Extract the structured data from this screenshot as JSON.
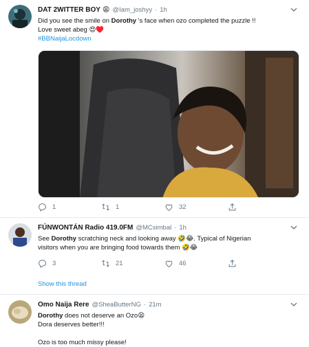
{
  "tweets": [
    {
      "name": "DAT 2WITTER BOY",
      "name_emoji": "😩",
      "handle": "@Iam_joshyy",
      "dot": "·",
      "time": "1h",
      "text_pre": "Did you see the smile on ",
      "text_bold": "Dorothy",
      "text_post": " 's face when ozo completed the puzzle !!",
      "text_line2": "Love sweet abeg 😍♥️",
      "hashtag": "#BBNaijaLocdown",
      "reply_count": "1",
      "retweet_count": "1",
      "like_count": "32"
    },
    {
      "name": "FÚNWONTÁN Radio 419.0FM",
      "handle": "@MCsimbal",
      "dot": "·",
      "time": "1h",
      "text_pre": "See ",
      "text_bold": "Dorothy",
      "text_post": " scratching neck and looking away 🤣😂. Typical of Nigerian",
      "text_line2": "visitors when you are bringing food towards them 🤣😂",
      "reply_count": "3",
      "retweet_count": "21",
      "like_count": "46",
      "show_thread": "Show this thread"
    },
    {
      "name": "Omo Naija Rere",
      "handle": "@SheaButterNG",
      "dot": "·",
      "time": "21m",
      "text_bold": "Dorothy",
      "text_post": " does not deserve an Ozo😫",
      "text_line2": "Dora deserves better!!!",
      "text_line3": "Ozo is too much missy please!"
    }
  ],
  "colors": {
    "link": "#1b95e0",
    "muted": "#657786",
    "divider": "#e6ecf0"
  },
  "icons": [
    "reply-icon",
    "retweet-icon",
    "like-icon",
    "share-icon",
    "caret-down-icon"
  ]
}
